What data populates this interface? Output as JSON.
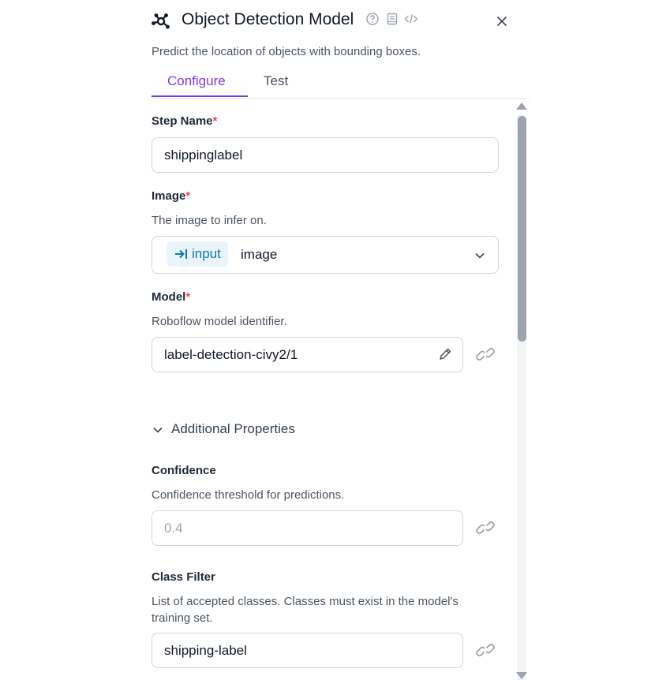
{
  "header": {
    "title": "Object Detection Model",
    "subtitle": "Predict the location of objects with bounding boxes.",
    "icons": [
      "model-graph-icon",
      "help-circle-icon",
      "docs-book-icon",
      "code-icon",
      "close-icon"
    ]
  },
  "tabs": [
    {
      "label": "Configure",
      "active": true
    },
    {
      "label": "Test",
      "active": false
    }
  ],
  "form": {
    "step_name": {
      "label": "Step Name",
      "required_mark": "*",
      "value": "shippinglabel"
    },
    "image": {
      "label": "Image",
      "required_mark": "*",
      "description": "The image to infer on.",
      "chip_label": "input",
      "value": "image"
    },
    "model": {
      "label": "Model",
      "required_mark": "*",
      "description": "Roboflow model identifier.",
      "value": "label-detection-civy2/1"
    },
    "additional": {
      "label": "Additional Properties",
      "expanded": true
    },
    "confidence": {
      "label": "Confidence",
      "description": "Confidence threshold for predictions.",
      "placeholder": "0.4"
    },
    "class_filter": {
      "label": "Class Filter",
      "description": "List of accepted classes. Classes must exist in the model's training set.",
      "value": "shipping-label"
    }
  },
  "colors": {
    "accent": "#7c3aed",
    "required": "#ef4444",
    "chip_bg": "#eaf4fb",
    "chip_text": "#0b7bb5"
  }
}
